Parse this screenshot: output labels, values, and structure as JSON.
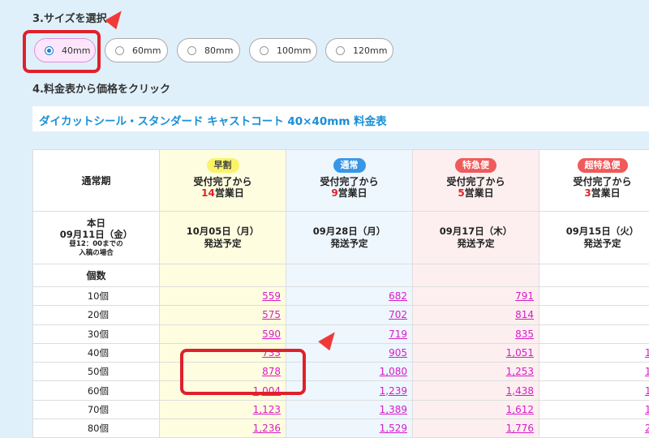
{
  "steps": {
    "size_title": "3.サイズを選択",
    "price_title": "4.料金表から価格をクリック"
  },
  "sizes": [
    {
      "label": "40mm",
      "selected": true
    },
    {
      "label": "60mm",
      "selected": false
    },
    {
      "label": "80mm",
      "selected": false
    },
    {
      "label": "100mm",
      "selected": false
    },
    {
      "label": "120mm",
      "selected": false
    }
  ],
  "table": {
    "heading": "ダイカットシール・スタンダード キャストコート 40×40mm 料金表",
    "label_header": "通常期",
    "columns": [
      {
        "badge": "早割",
        "line": "受付完了から",
        "days": "14",
        "unit": "営業日",
        "ship_date": "10月05日（月）",
        "ship_label": "発送予定"
      },
      {
        "badge": "通常",
        "line": "受付完了から",
        "days": "9",
        "unit": "営業日",
        "ship_date": "09月28日（月）",
        "ship_label": "発送予定"
      },
      {
        "badge": "特急便",
        "line": "受付完了から",
        "days": "5",
        "unit": "営業日",
        "ship_date": "09月17日（木）",
        "ship_label": "発送予定"
      },
      {
        "badge": "超特急便",
        "line": "受付完了から",
        "days": "3",
        "unit": "営業日",
        "ship_date": "09月15日（火）",
        "ship_label": "発送予定"
      }
    ],
    "today": {
      "label": "本日",
      "date": "09月11日（金）",
      "note1": "昼12：00までの",
      "note2": "入稿の場合"
    },
    "count_header": "個数",
    "rows": [
      {
        "qty": "10個",
        "prices": [
          "559",
          "682",
          "791",
          "9"
        ]
      },
      {
        "qty": "20個",
        "prices": [
          "575",
          "702",
          "814",
          "9"
        ]
      },
      {
        "qty": "30個",
        "prices": [
          "590",
          "719",
          "835",
          "1"
        ]
      },
      {
        "qty": "40個",
        "prices": [
          "733",
          "905",
          "1,051",
          "1,2"
        ]
      },
      {
        "qty": "50個",
        "prices": [
          "878",
          "1,080",
          "1,253",
          "1,5"
        ]
      },
      {
        "qty": "60個",
        "prices": [
          "1,004",
          "1,239",
          "1,438",
          "1,7"
        ]
      },
      {
        "qty": "70個",
        "prices": [
          "1,123",
          "1,389",
          "1,612",
          "1,9"
        ]
      },
      {
        "qty": "80個",
        "prices": [
          "1,236",
          "1,529",
          "1,776",
          "2,1"
        ]
      }
    ]
  },
  "colors": {
    "background": "#dff0fb",
    "highlight": "#e0202a",
    "price_link": "#d81bc9",
    "heading_text": "#1a8fd6"
  }
}
